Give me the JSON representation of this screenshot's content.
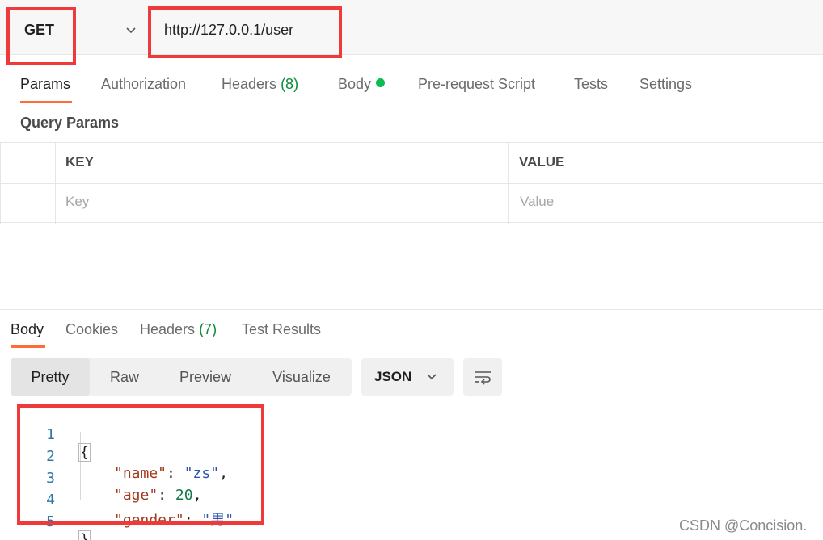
{
  "request": {
    "method": "GET",
    "url": "http://127.0.0.1/user"
  },
  "request_tabs": [
    {
      "label": "Params",
      "active": true
    },
    {
      "label": "Authorization"
    },
    {
      "label": "Headers",
      "count": "(8)"
    },
    {
      "label": "Body",
      "indicator": "green-dot"
    },
    {
      "label": "Pre-request Script"
    },
    {
      "label": "Tests"
    },
    {
      "label": "Settings"
    }
  ],
  "query_params": {
    "title": "Query Params",
    "columns": [
      "KEY",
      "VALUE"
    ],
    "placeholder_row": {
      "key": "Key",
      "value": "Value"
    }
  },
  "response_tabs": [
    {
      "label": "Body",
      "active": true
    },
    {
      "label": "Cookies"
    },
    {
      "label": "Headers",
      "count": "(7)"
    },
    {
      "label": "Test Results"
    }
  ],
  "view_modes": [
    "Pretty",
    "Raw",
    "Preview",
    "Visualize"
  ],
  "active_view_mode": "Pretty",
  "format_select": "JSON",
  "code_lines": [
    {
      "n": "1",
      "text": "{"
    },
    {
      "n": "2",
      "key": "\"name\"",
      "value": "\"zs\"",
      "trail": ","
    },
    {
      "n": "3",
      "key": "\"age\"",
      "value": "20",
      "trail": ","
    },
    {
      "n": "4",
      "key": "\"gender\"",
      "value": "\"男\"",
      "trail": ""
    },
    {
      "n": "5",
      "text": "}"
    }
  ],
  "watermark": "CSDN @Concision.",
  "colors": {
    "accent": "#ff6c37",
    "highlight_box": "#ee3a3a",
    "green": "#0cbb52"
  },
  "icons": [
    "chevron-down-icon",
    "wrap-lines-icon"
  ]
}
